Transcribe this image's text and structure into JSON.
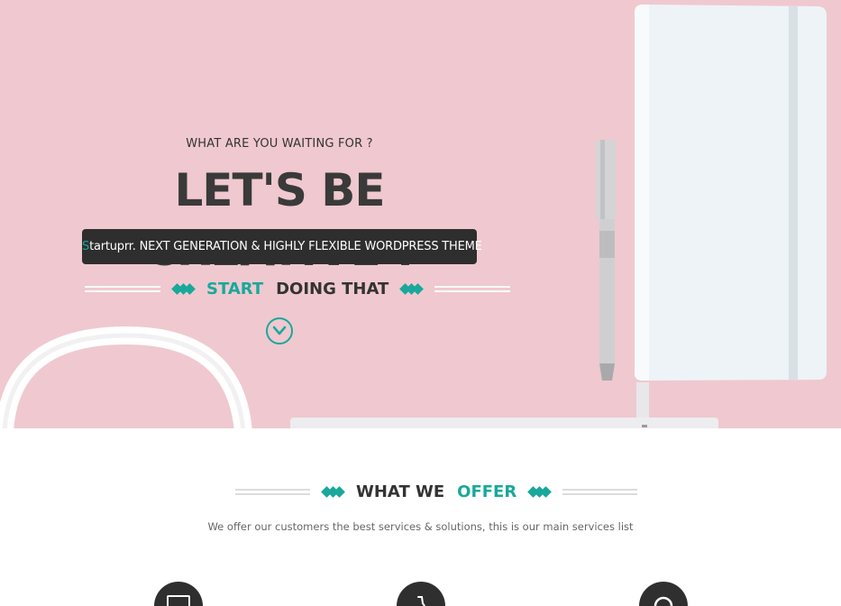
{
  "hero": {
    "pretitle": "WHAT ARE YOU WAITING FOR ?",
    "title": "LET'S BE CREATIVE !",
    "tagline_highlight": "S",
    "tagline_rest": "tartuprr. NEXT GENERATION & HIGHLY FLEXIBLE WORDPRESS THEME",
    "cta_word1": "START",
    "cta_word2": "DOING THAT",
    "background_color": "#efc9cf"
  },
  "offer": {
    "title_word1": "WHAT WE",
    "title_word2": "OFFER",
    "description": "We offer our customers the best services & solutions, this is our main services list"
  },
  "services": [
    {
      "icon": "monitor-icon"
    },
    {
      "icon": "pen-icon"
    },
    {
      "icon": "palette-icon"
    }
  ],
  "colors": {
    "accent": "#19a89b",
    "dark": "#333333",
    "hero_bg": "#efc9cf"
  }
}
